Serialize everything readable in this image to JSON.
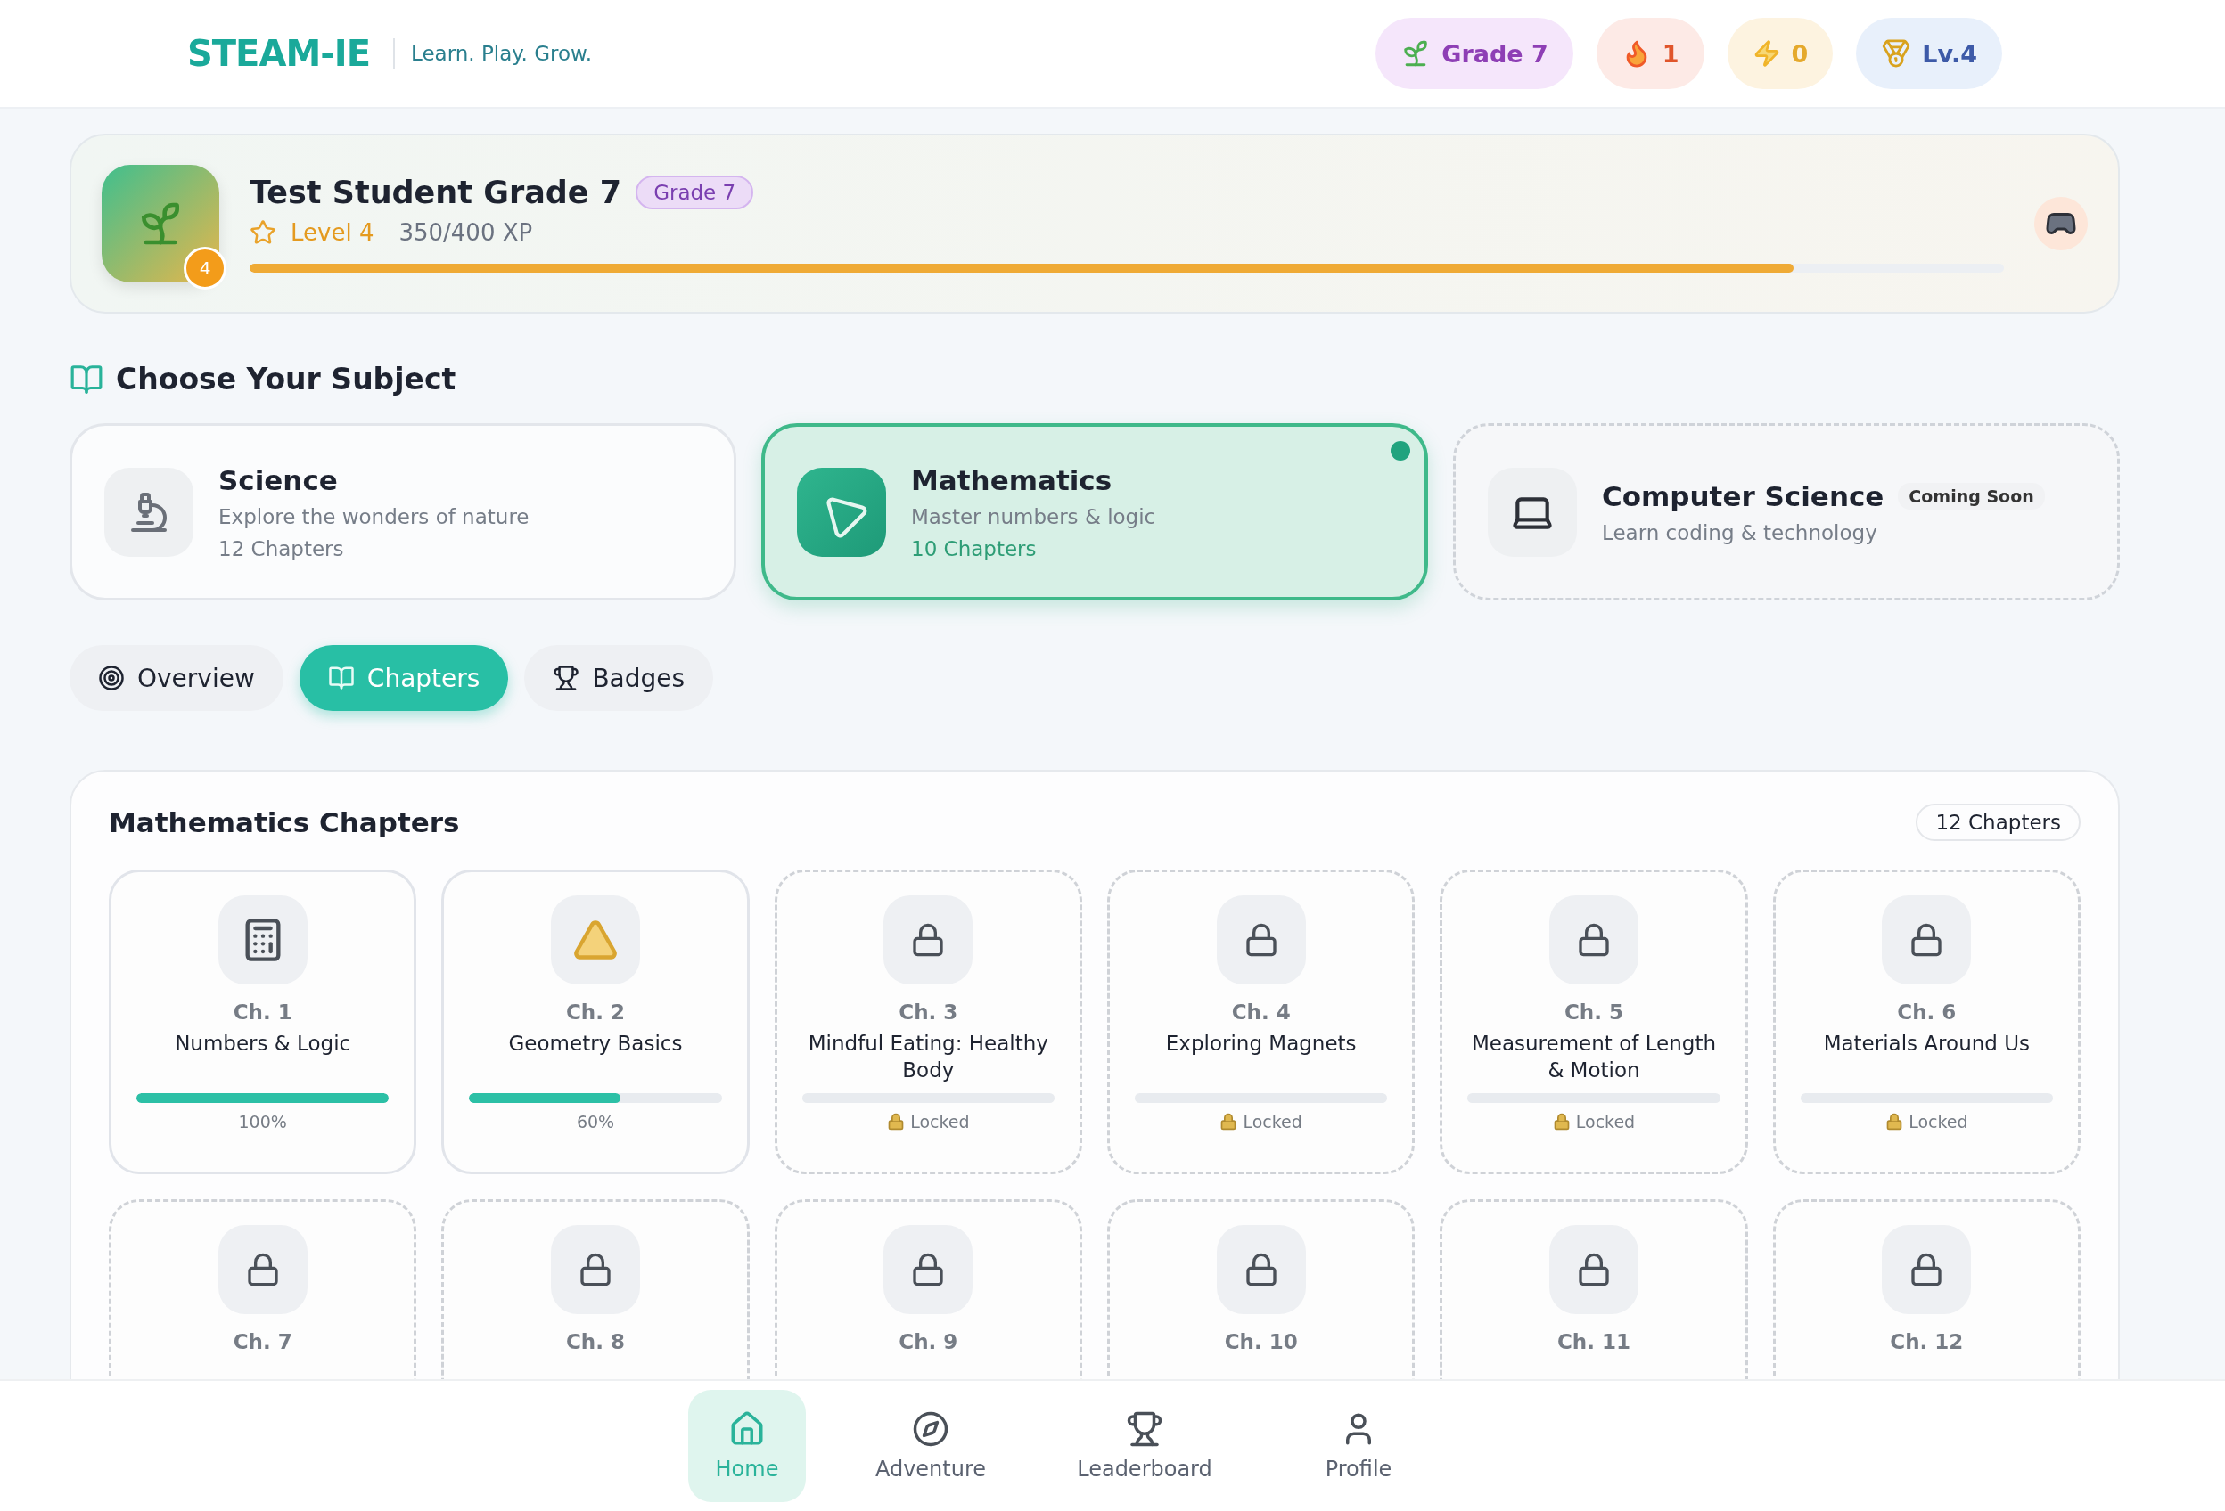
{
  "header": {
    "logo": "STEAM-IE",
    "tagline": "Learn. Play. Grow.",
    "stats": [
      {
        "kind": "grade",
        "label": "Grade 7"
      },
      {
        "kind": "streak",
        "label": "1"
      },
      {
        "kind": "energy",
        "label": "0"
      },
      {
        "kind": "level",
        "label": "Lv.4"
      }
    ]
  },
  "profile": {
    "name": "Test Student Grade 7",
    "grade_badge": "Grade 7",
    "avatar_badge": "4",
    "level_label": "Level 4",
    "xp": "350/400 XP",
    "level": 0.88
  },
  "subjects_section": {
    "title": "Choose Your Subject"
  },
  "subjects": [
    {
      "kind": "available",
      "name": "Science",
      "description": "Explore the wonders of nature",
      "chapters": "12 Chapters",
      "selected": false
    },
    {
      "kind": "available",
      "name": "Mathematics",
      "description": "Master numbers & logic",
      "chapters": "10 Chapters",
      "selected": true
    },
    {
      "kind": "coming_soon",
      "name": "Computer Science",
      "badge": "Coming Soon",
      "description": "Learn coding & technology",
      "selected": false
    }
  ],
  "tabs": [
    {
      "label": "Overview",
      "selected": false
    },
    {
      "label": "Chapters",
      "selected": true
    },
    {
      "label": "Badges",
      "selected": false
    }
  ],
  "chapters_panel": {
    "title": "Mathematics Chapters",
    "count": "12 Chapters"
  },
  "chapters": [
    {
      "number": "Ch. 1",
      "title": "Numbers & Logic",
      "locked": false,
      "level": 1,
      "reading": "100%"
    },
    {
      "number": "Ch. 2",
      "title": "Geometry Basics",
      "locked": false,
      "level": 0.6,
      "reading": "60%"
    },
    {
      "number": "Ch. 3",
      "title": "Mindful Eating: Healthy Body",
      "locked": true,
      "status": "Locked"
    },
    {
      "number": "Ch. 4",
      "title": "Exploring Magnets",
      "locked": true,
      "status": "Locked"
    },
    {
      "number": "Ch. 5",
      "title": "Measurement of Length & Motion",
      "locked": true,
      "status": "Locked"
    },
    {
      "number": "Ch. 6",
      "title": "Materials Around Us",
      "locked": true,
      "status": "Locked"
    },
    {
      "number": "Ch. 7",
      "locked": true
    },
    {
      "number": "Ch. 8",
      "locked": true
    },
    {
      "number": "Ch. 9",
      "locked": true
    },
    {
      "number": "Ch. 10",
      "locked": true
    },
    {
      "number": "Ch. 11",
      "locked": true
    },
    {
      "number": "Ch. 12",
      "locked": true
    }
  ],
  "bottom_nav": [
    {
      "label": "Home",
      "selected": true
    },
    {
      "label": "Adventure",
      "selected": false
    },
    {
      "label": "Leaderboard",
      "selected": false
    },
    {
      "label": "Profile",
      "selected": false
    }
  ]
}
